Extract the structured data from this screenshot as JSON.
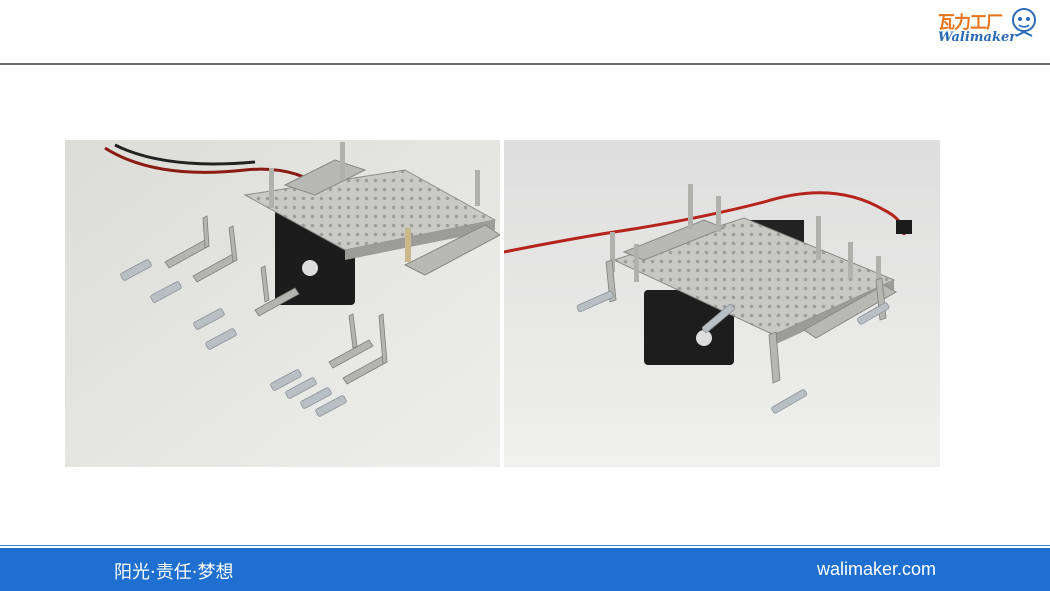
{
  "header": {
    "logo": {
      "text_cn": "瓦力工厂",
      "text_en": "Walimaker"
    }
  },
  "footer": {
    "slogan": "阳光·责任·梦想",
    "site": "walimaker.com"
  },
  "colors": {
    "footer_bar": "#1f6fd1",
    "header_rule": "#6b6b6b",
    "logo_orange": "#e8731a",
    "logo_blue": "#2b6bb5"
  }
}
